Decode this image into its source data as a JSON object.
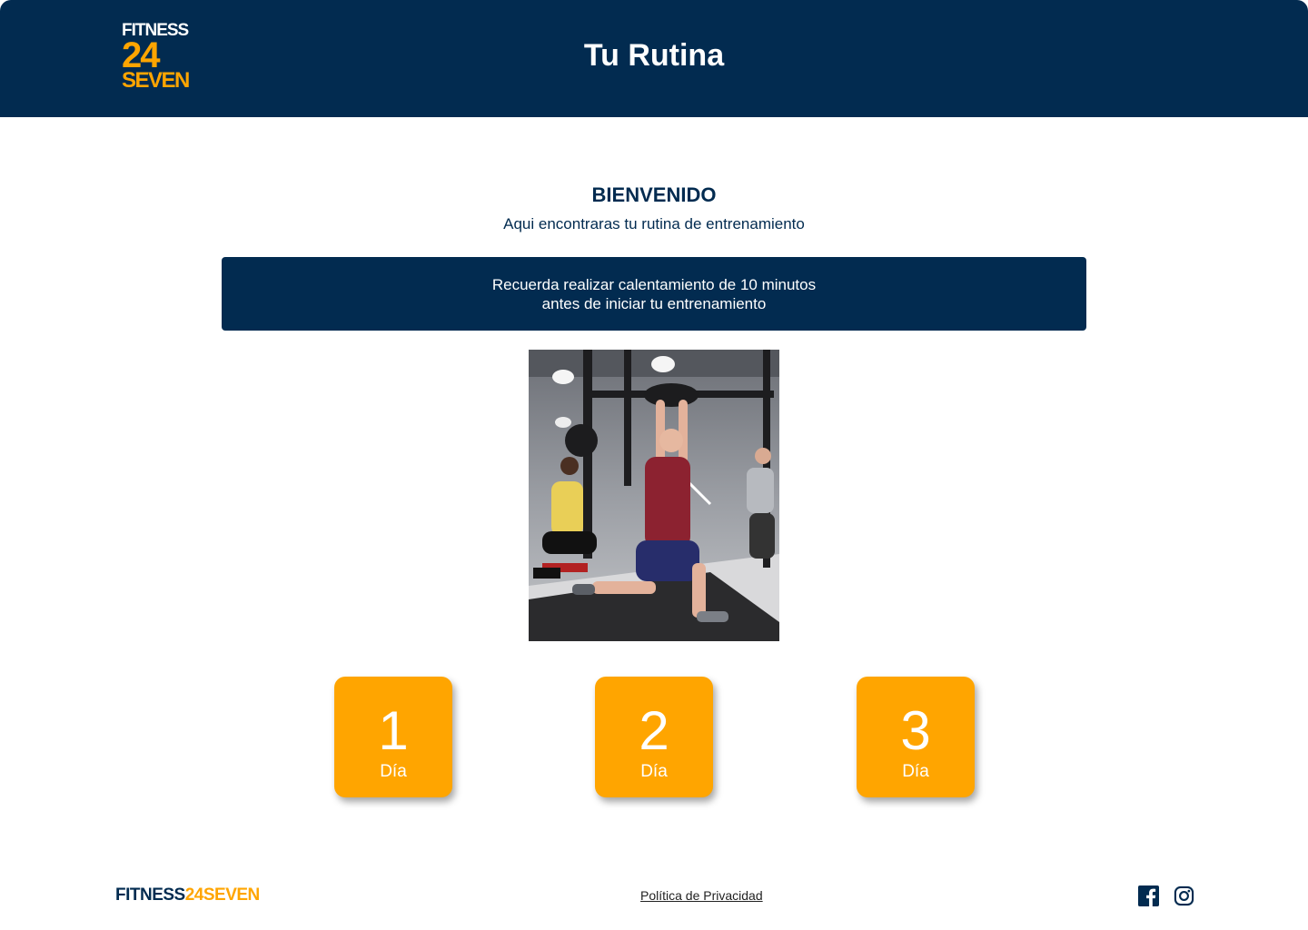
{
  "header": {
    "logo": {
      "line1": "FITNESS",
      "line2": "24",
      "line3": "SEVEN"
    },
    "title": "Tu Rutina"
  },
  "main": {
    "welcome": "BIENVENIDO",
    "subtitle": "Aqui encontraras tu rutina de entrenamiento",
    "notice": "Recuerda realizar calentamiento de 10 minutos\nantes de iniciar tu entrenamiento",
    "days": [
      {
        "number": "1",
        "label": "Día"
      },
      {
        "number": "2",
        "label": "Día"
      },
      {
        "number": "3",
        "label": "Día"
      }
    ]
  },
  "footer": {
    "logo": {
      "part1": "FITNESS",
      "part2": "24SEVEN"
    },
    "privacy_link": "Política de Privacidad",
    "social_icons": [
      "facebook-icon",
      "instagram-icon"
    ]
  },
  "colors": {
    "navy": "#022b50",
    "orange": "#ffa500",
    "white": "#ffffff"
  }
}
